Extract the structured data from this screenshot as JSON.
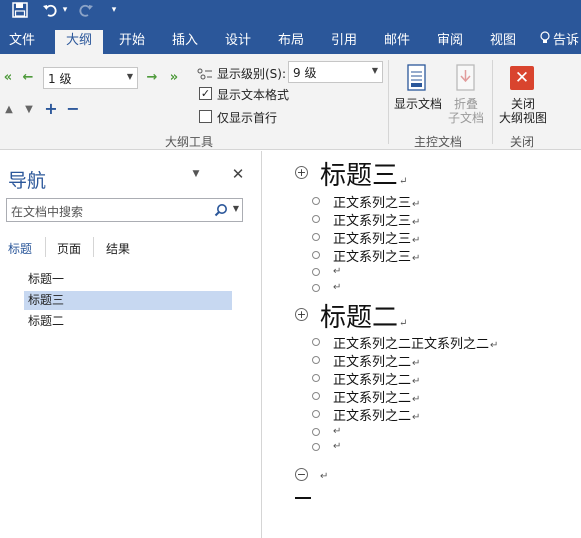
{
  "titlebar": {
    "save_icon": "save-icon",
    "undo_icon": "undo-icon",
    "undo_dropdown": "▾",
    "redo_icon": "redo-icon",
    "customize_icon": "▾"
  },
  "tabs": [
    {
      "label": "文件"
    },
    {
      "label": "大纲"
    },
    {
      "label": "开始"
    },
    {
      "label": "插入"
    },
    {
      "label": "设计"
    },
    {
      "label": "布局"
    },
    {
      "label": "引用"
    },
    {
      "label": "邮件"
    },
    {
      "label": "审阅"
    },
    {
      "label": "视图"
    },
    {
      "label": "告诉"
    }
  ],
  "ribbon": {
    "outline_level_value": "1 级",
    "show_level_label": "显示级别(S):",
    "show_level_value": "9 级",
    "show_text_format_label": "显示文本格式",
    "show_text_format_checked": "✓",
    "show_first_line_label": "仅显示首行",
    "outline_tools_label": "大纲工具",
    "show_document_label": "显示文档",
    "collapse_label_1": "折叠",
    "collapse_label_2": "子文档",
    "master_document_label": "主控文档",
    "close_label_1": "关闭",
    "close_label_2": "大纲视图",
    "close_group_label": "关闭"
  },
  "nav": {
    "title": "导航",
    "search_placeholder": "在文档中搜索",
    "tabs": [
      "标题",
      "页面",
      "结果"
    ],
    "headings": [
      "标题一",
      "标题三",
      "标题二"
    ]
  },
  "document": {
    "sections": [
      {
        "heading": "标题三",
        "lines": [
          "正文系列之三",
          "正文系列之三",
          "正文系列之三",
          "正文系列之三",
          "",
          ""
        ]
      },
      {
        "heading": "标题二",
        "lines": [
          "正文系列之二正文系列之二",
          "正文系列之二",
          "正文系列之二",
          "正文系列之二",
          "正文系列之二",
          "",
          ""
        ]
      }
    ],
    "paragraph_mark": "↵",
    "expand_symbol": "+",
    "collapse_symbol": "−"
  },
  "colors": {
    "accent": "#2b579a",
    "ribbon_bg": "#f3f3f3",
    "selection": "#c7d8f1",
    "close_red": "#d9442e",
    "arrow_green": "#4e9a3b"
  }
}
